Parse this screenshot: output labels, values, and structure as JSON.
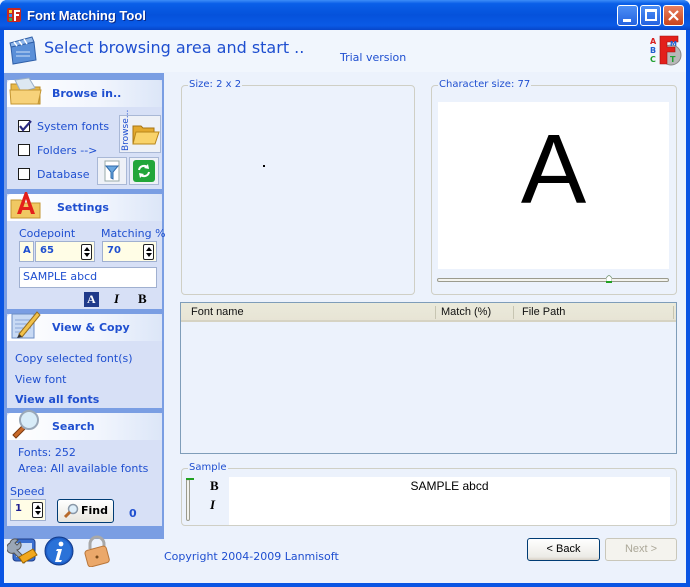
{
  "window": {
    "title": "Font Matching Tool"
  },
  "header": {
    "title": "Select browsing area and start ..",
    "edition": "Trial version"
  },
  "sidebar": {
    "browse": {
      "title": "Browse in..",
      "options": [
        {
          "label": "System fonts",
          "checked": true
        },
        {
          "label": "Folders -->",
          "checked": false
        },
        {
          "label": "Database",
          "checked": false
        }
      ],
      "browse_button_label": "Browse..."
    },
    "settings": {
      "title": "Settings",
      "codepoint_label": "Codepoint",
      "codepoint_char": "A",
      "codepoint_value": "65",
      "matching_label": "Matching %",
      "matching_value": "70",
      "sample_text": "SAMPLE abcd",
      "italic_glyph": "I",
      "bold_glyph": "B"
    },
    "view_copy": {
      "title": "View & Copy",
      "links": [
        "Copy selected font(s)",
        "View font",
        "View all fonts"
      ]
    },
    "search": {
      "title": "Search",
      "fonts_count": "Fonts: 252",
      "area": "Area: All available fonts",
      "speed_label": "Speed",
      "speed_value": "1",
      "find_label": "Find",
      "found_count": "0"
    }
  },
  "main": {
    "size_group": {
      "label": "Size: 2 x 2"
    },
    "char_group": {
      "label": "Character size: 77",
      "character": "A",
      "slider_value_fraction": 0.75
    },
    "table": {
      "columns": [
        "Font name",
        "Match (%)",
        "File Path"
      ],
      "rows": []
    },
    "sample_group": {
      "label": "Sample",
      "text": "SAMPLE abcd",
      "bold_glyph": "B",
      "italic_glyph": "I"
    }
  },
  "footer": {
    "copyright": "Copyright 2004-2009 Lanmisoft",
    "back_label": "< Back",
    "next_label": "Next >"
  },
  "colors": {
    "accent_text": "#1F4FD0",
    "titlebar": "#0552DB",
    "sidebar": "#7A9EE3",
    "panel": "#D7E0F6"
  }
}
